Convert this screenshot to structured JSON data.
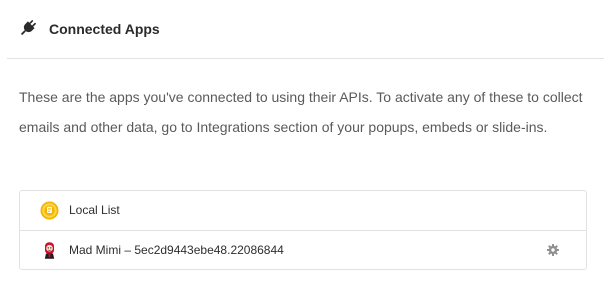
{
  "header": {
    "title": "Connected Apps",
    "icon": "plug-icon"
  },
  "description": "These are the apps you've connected to using their APIs. To activate any of these to collect emails and other data, go to Integrations section of your popups, embeds or slide-ins.",
  "apps": [
    {
      "name": "Local List",
      "icon": "local-list-icon",
      "icon_color": "#f2b600"
    },
    {
      "name": "Mad Mimi – 5ec2d9443ebe48.22086844",
      "icon": "mad-mimi-icon",
      "icon_color": "#c8102e",
      "settings_icon": "gear-icon"
    }
  ],
  "colors": {
    "text": "#5a5a5a",
    "border": "#e2e2e2",
    "gear": "#8f8f8f"
  }
}
